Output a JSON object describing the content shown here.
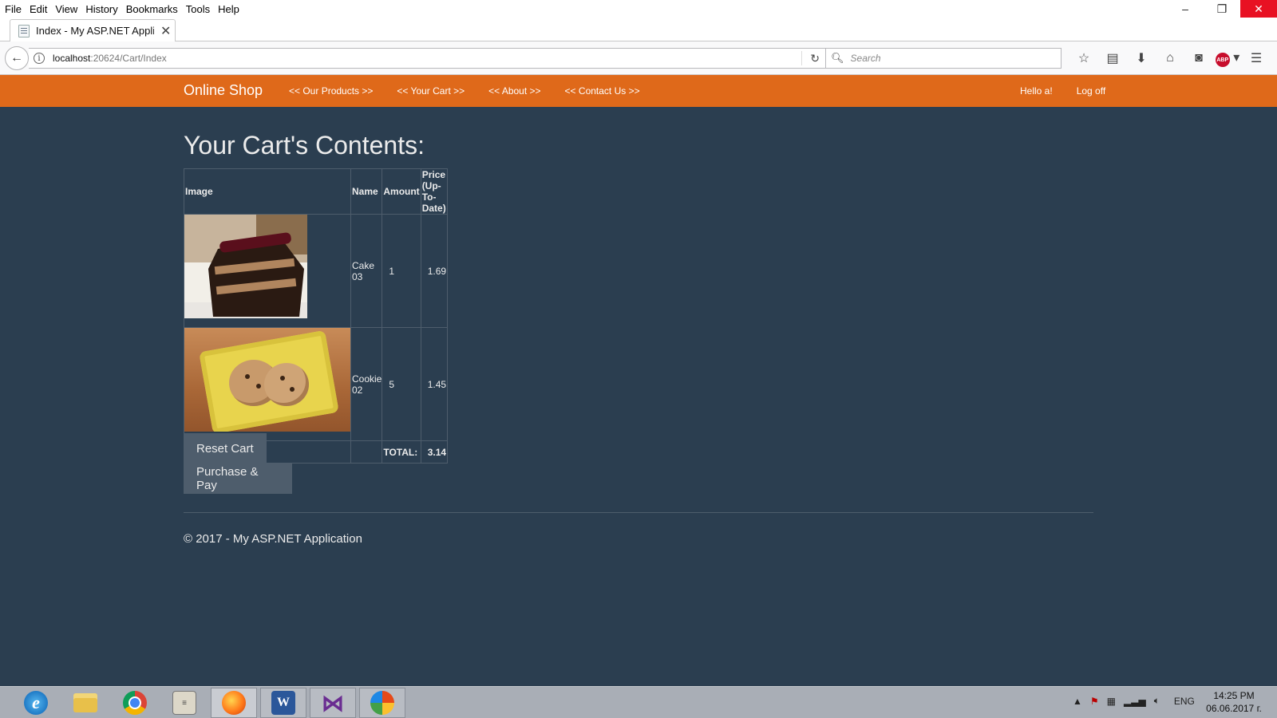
{
  "menubar": {
    "items": [
      "File",
      "Edit",
      "View",
      "History",
      "Bookmarks",
      "Tools",
      "Help"
    ]
  },
  "window_controls": {
    "minimize": "–",
    "restore": "❐",
    "close": "✕"
  },
  "tab": {
    "title": "Index - My ASP.NET Applica",
    "close": "✕",
    "new_tab": "+"
  },
  "navbar": {
    "back": "←",
    "url_host": "localhost",
    "url_path": ":20624/Cart/Index",
    "reload": "↻",
    "search_placeholder": "Search",
    "toolbar_icons": [
      "bookmark-star-icon",
      "reading-list-icon",
      "download-icon",
      "home-icon",
      "pocket-icon",
      "adblock-icon",
      "menu-icon"
    ]
  },
  "site": {
    "brand": "Online Shop",
    "nav_links": [
      "<< Our Products >>",
      "<< Your Cart >>",
      "<< About >>",
      "<< Contact Us >>"
    ],
    "greeting": "Hello a!",
    "logoff": "Log off"
  },
  "page": {
    "title": "Your Cart's Contents:",
    "table": {
      "headers": [
        "Image",
        "Name",
        "Amount",
        "Price (Up-To-Date)"
      ],
      "rows": [
        {
          "image": "chocolate cake slice",
          "name": "Cake 03",
          "amount": "1",
          "price": "1.69"
        },
        {
          "image": "cookies on yellow plate",
          "name": "Cookie 02",
          "amount": "5",
          "price": "1.45"
        }
      ],
      "total_label": "TOTAL:",
      "total_value": "3.14"
    },
    "buttons": {
      "reset": "Reset Cart",
      "purchase": "Purchase & Pay"
    },
    "footer": "© 2017 - My ASP.NET Application"
  },
  "taskbar": {
    "apps": [
      "internet-explorer",
      "file-explorer",
      "chrome",
      "notepad",
      "firefox",
      "word",
      "visual-studio",
      "paint"
    ],
    "active_app": "firefox",
    "tray": {
      "language": "ENG"
    },
    "clock": {
      "time": "14:25 PM",
      "date": "06.06.2017 г."
    }
  }
}
